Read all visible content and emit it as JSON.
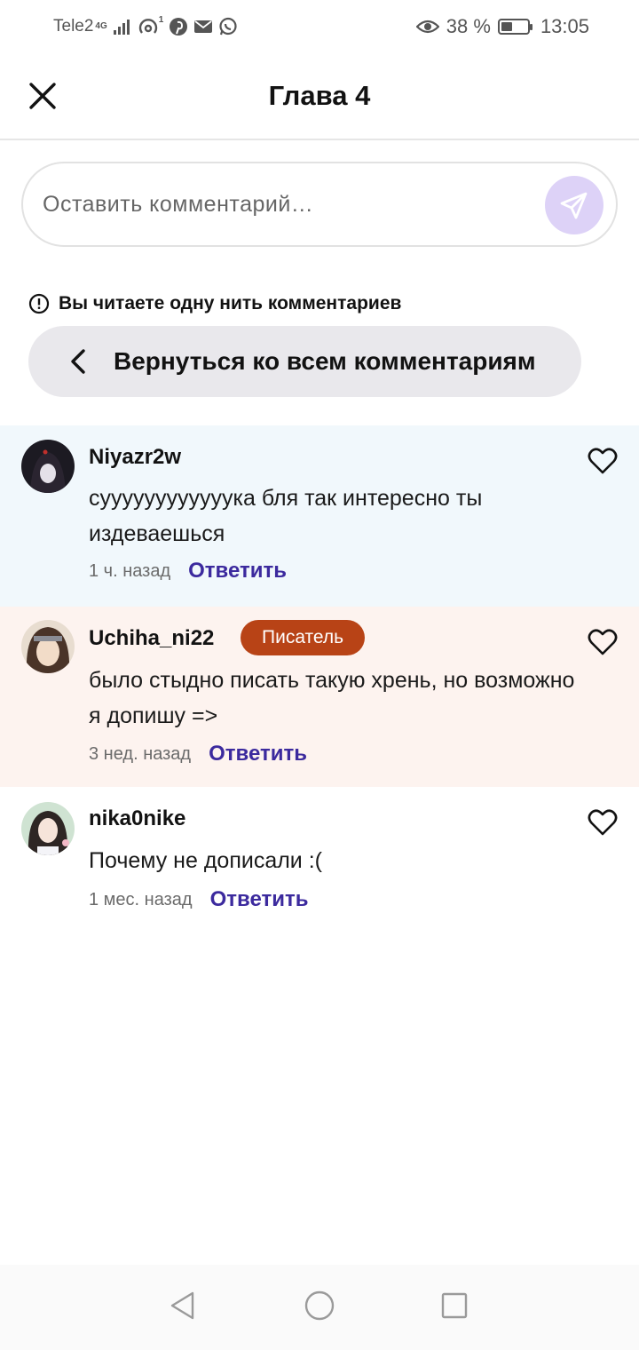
{
  "status_bar": {
    "carrier": "Tele2",
    "network": "4G",
    "hotspot_count": "1",
    "battery_text": "38 %",
    "battery_level": 0.38,
    "time": "13:05",
    "icons": [
      "signal-icon",
      "hotspot-icon",
      "pinterest-icon",
      "mail-icon",
      "whatsapp-icon",
      "eye-icon",
      "battery-icon"
    ]
  },
  "header": {
    "title": "Глава 4"
  },
  "comment_input": {
    "placeholder": "Оставить комментарий…"
  },
  "thread": {
    "notice": "Вы читаете одну нить комментариев",
    "back_label": "Вернуться ко всем комментариям"
  },
  "comments": [
    {
      "username": "Niyazr2w",
      "text": "суууууууууууука бля так интересно ты издеваешься",
      "time": "1 ч. назад",
      "reply": "Ответить"
    },
    {
      "username": "Uchiha_ni22",
      "badge": "Писатель",
      "text": "было стыдно писать такую хрень, но возможно я допишу =>",
      "time": "3 нед. назад",
      "reply": "Ответить"
    },
    {
      "username": "nika0nike",
      "text": "Почему не дописали :(",
      "time": "1 мес. назад",
      "reply": "Ответить"
    }
  ],
  "colors": {
    "accent": "#3c2a9e",
    "send_button": "#ddd2f7",
    "badge": "#b84316",
    "comment1_bg": "#f1f8fc",
    "comment2_bg": "#fdf3ef"
  }
}
